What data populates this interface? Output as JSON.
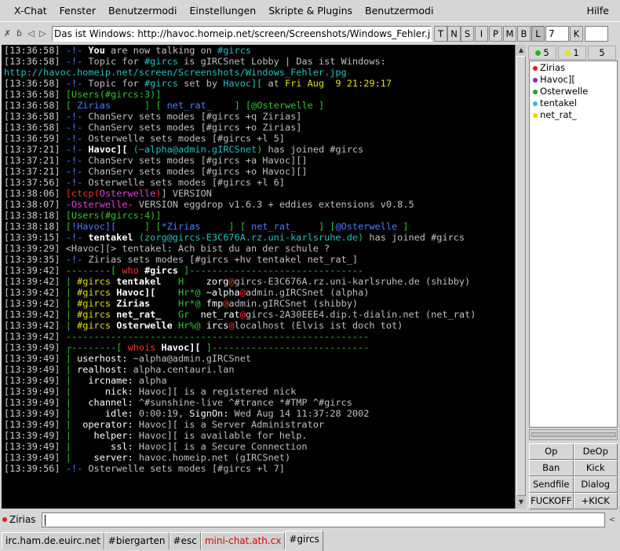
{
  "menubar": {
    "items": [
      "X-Chat",
      "Fenster",
      "Benutzermodi",
      "Einstellungen",
      "Skripte & Plugins",
      "Benutzermodi"
    ],
    "help": "Hilfe"
  },
  "topic": {
    "text": "Das ist Windows: http://havoc.homeip.net/screen/Screenshots/Windows_Fehler.jpg",
    "modes": [
      "T",
      "N",
      "S",
      "I",
      "P",
      "M",
      "B",
      "L"
    ],
    "limit_value": "7",
    "key_label": "K"
  },
  "counts": [
    {
      "color": "#22bb22",
      "value": "5"
    },
    {
      "color": "#e6e600",
      "value": "1"
    },
    {
      "value": "5"
    }
  ],
  "users": [
    {
      "name": "Zirias",
      "color": "#e02020"
    },
    {
      "name": "Havoc][",
      "color": "#9a20c0"
    },
    {
      "name": "Osterwelle",
      "color": "#20a020"
    },
    {
      "name": "tentakel",
      "color": "#20c0e0"
    },
    {
      "name": "net_rat_",
      "color": "#e6d600"
    }
  ],
  "user_buttons": [
    "Op",
    "DeOp",
    "Ban",
    "Kick",
    "Sendfile",
    "Dialog",
    "FUCKOFF",
    "+KICK"
  ],
  "input": {
    "nick": "Zirias",
    "nick_color": "#e02020",
    "value": ""
  },
  "tabs": [
    {
      "label": "irc.ham.de.euirc.net"
    },
    {
      "label": "#biergarten"
    },
    {
      "label": "#esc"
    },
    {
      "label": "mini-chat.ath.cx",
      "red": true
    },
    {
      "label": "#gircs",
      "active": true
    }
  ],
  "chat_lines": [
    [
      [
        "[13:36:58] ",
        "ts"
      ],
      [
        "-!-",
        "c-blue"
      ],
      [
        " You",
        "c-w"
      ],
      [
        " are now talking on ",
        ""
      ],
      [
        "#gircs",
        "c-cyan"
      ]
    ],
    [
      [
        "[13:36:58] ",
        "ts"
      ],
      [
        "-!-",
        "c-blue"
      ],
      [
        " Topic for ",
        ""
      ],
      [
        "#gircs",
        "c-cyan"
      ],
      [
        " is gIRCSnet Lobby | Das ist Windows:",
        ""
      ]
    ],
    [
      [
        "http://havoc.homeip.net/screen/Screenshots/Windows_Fehler.jpg",
        "c-cyan"
      ]
    ],
    [
      [
        "[13:36:58] ",
        "ts"
      ],
      [
        "-!-",
        "c-blue"
      ],
      [
        " Topic for ",
        ""
      ],
      [
        "#gircs",
        "c-cyan"
      ],
      [
        " set by ",
        ""
      ],
      [
        "Havoc][",
        "c-cyan"
      ],
      [
        " at ",
        ""
      ],
      [
        "Fri Aug  9 21:29:17",
        "c-yel"
      ]
    ],
    [
      [
        "[13:36:58] ",
        "ts"
      ],
      [
        "[",
        "c-grn"
      ],
      [
        "Users(#gircs:3)",
        "c-grn"
      ],
      [
        "]",
        "c-grn"
      ]
    ],
    [
      [
        "[13:36:58] ",
        "ts"
      ],
      [
        "[",
        "c-grn"
      ],
      [
        " Zirias      ",
        "c-blue"
      ],
      [
        "] [",
        "c-grn"
      ],
      [
        " net_rat_    ",
        "c-blue"
      ],
      [
        "] [",
        "c-grn"
      ],
      [
        "@Osterwelle ",
        "c-grn"
      ],
      [
        "]",
        "c-grn"
      ]
    ],
    [
      [
        "[13:36:58] ",
        "ts"
      ],
      [
        "-!-",
        "c-blue"
      ],
      [
        " ChanServ sets modes [#gircs +q Zirias]",
        ""
      ]
    ],
    [
      [
        "[13:36:58] ",
        "ts"
      ],
      [
        "-!-",
        "c-blue"
      ],
      [
        " ChanServ sets modes [#gircs +o Zirias]",
        ""
      ]
    ],
    [
      [
        "[13:36:59] ",
        "ts"
      ],
      [
        "-!-",
        "c-blue"
      ],
      [
        " Osterwelle sets modes [#gircs +l 5]",
        ""
      ]
    ],
    [
      [
        "[13:37:21] ",
        "ts"
      ],
      [
        "-!-",
        "c-blue"
      ],
      [
        " Havoc][",
        "c-w"
      ],
      [
        " (",
        "c-grn"
      ],
      [
        "~alpha@admin.gIRCSnet",
        "c-cyan"
      ],
      [
        ")",
        "c-grn"
      ],
      [
        " has joined #gircs",
        ""
      ]
    ],
    [
      [
        "[13:37:21] ",
        "ts"
      ],
      [
        "-!-",
        "c-blue"
      ],
      [
        " ChanServ sets modes [#gircs +a Havoc][]",
        ""
      ]
    ],
    [
      [
        "[13:37:21] ",
        "ts"
      ],
      [
        "-!-",
        "c-blue"
      ],
      [
        " ChanServ sets modes [#gircs +o Havoc][]",
        ""
      ]
    ],
    [
      [
        "[13:37:56] ",
        "ts"
      ],
      [
        "-!-",
        "c-blue"
      ],
      [
        " Osterwelle sets modes [#gircs +l 6]",
        ""
      ]
    ],
    [
      [
        "[13:38:06] ",
        "ts"
      ],
      [
        "[",
        "c-red"
      ],
      [
        "ctcp",
        "c-red"
      ],
      [
        "(",
        "c-red"
      ],
      [
        "Osterwelle",
        "c-mag"
      ],
      [
        ")",
        "c-red"
      ],
      [
        "] VERSION",
        ""
      ]
    ],
    [
      [
        "[13:38:07] ",
        "ts"
      ],
      [
        "-",
        "c-mag"
      ],
      [
        "Osterwelle",
        "c-mag"
      ],
      [
        "-",
        "c-mag"
      ],
      [
        " VERSION eggdrop v1.6.3 + eddies extensions v0.8.5",
        ""
      ]
    ],
    [
      [
        "[13:38:18] ",
        "ts"
      ],
      [
        "[",
        "c-grn"
      ],
      [
        "Users(#gircs:4)",
        "c-grn"
      ],
      [
        "]",
        "c-grn"
      ]
    ],
    [
      [
        "[13:38:18] ",
        "ts"
      ],
      [
        "[",
        "c-grn"
      ],
      [
        "!Havoc][     ",
        "c-blue"
      ],
      [
        "] [",
        "c-grn"
      ],
      [
        "*Zirias     ",
        "c-blue"
      ],
      [
        "] [",
        "c-grn"
      ],
      [
        " net_rat_    ",
        "c-blue"
      ],
      [
        "] [",
        "c-grn"
      ],
      [
        "@Osterwelle ",
        "c-blue"
      ],
      [
        "]",
        "c-grn"
      ]
    ],
    [
      [
        "[13:39:15] ",
        "ts"
      ],
      [
        "-!-",
        "c-blue"
      ],
      [
        " tentakel",
        "c-w"
      ],
      [
        " (",
        "c-grn"
      ],
      [
        "zorg@gircs-E3C676A.rz.uni-karlsruhe.de",
        "c-cyan"
      ],
      [
        ")",
        "c-grn"
      ],
      [
        " has joined #gircs",
        ""
      ]
    ],
    [
      [
        "[13:39:29] ",
        "ts"
      ],
      [
        "<Havoc][> tentakel: Ach bist du an der schule ?",
        ""
      ]
    ],
    [
      [
        "[13:39:35] ",
        "ts"
      ],
      [
        "-!-",
        "c-blue"
      ],
      [
        " Zirias sets modes [#gircs +hv tentakel net_rat_]",
        ""
      ]
    ],
    [
      [
        "[13:39:42] ",
        "ts"
      ],
      [
        "--------[ ",
        "c-grn"
      ],
      [
        "who",
        "c-red"
      ],
      [
        " #gircs",
        "c-w"
      ],
      [
        " ]-------------------------------",
        "c-grn"
      ]
    ],
    [
      [
        "[13:39:42] ",
        "ts"
      ],
      [
        "| ",
        "c-grn"
      ],
      [
        "#gircs",
        "c-yel"
      ],
      [
        " tentakel",
        "c-w"
      ],
      [
        "   H  ",
        "c-grn"
      ],
      [
        "  zorg",
        "c-wh"
      ],
      [
        "@",
        "c-red"
      ],
      [
        "gircs-E3C676A.rz.uni-karlsruhe.de (shibby)",
        ""
      ]
    ],
    [
      [
        "[13:39:42] ",
        "ts"
      ],
      [
        "| ",
        "c-grn"
      ],
      [
        "#gircs",
        "c-yel"
      ],
      [
        " Havoc][",
        "c-w"
      ],
      [
        "    Hr*@",
        "c-grn"
      ],
      [
        " ~alpha",
        "c-wh"
      ],
      [
        "@",
        "c-red"
      ],
      [
        "admin.gIRCSnet (alpha)",
        ""
      ]
    ],
    [
      [
        "[13:39:42] ",
        "ts"
      ],
      [
        "| ",
        "c-grn"
      ],
      [
        "#gircs",
        "c-yel"
      ],
      [
        " Zirias",
        "c-w"
      ],
      [
        "     Hr*@",
        "c-grn"
      ],
      [
        " fmp",
        "c-wh"
      ],
      [
        "@",
        "c-red"
      ],
      [
        "admin.gIRCSnet (shibby)",
        ""
      ]
    ],
    [
      [
        "[13:39:42] ",
        "ts"
      ],
      [
        "| ",
        "c-grn"
      ],
      [
        "#gircs",
        "c-yel"
      ],
      [
        " net_rat_",
        "c-w"
      ],
      [
        "   Gr ",
        "c-grn"
      ],
      [
        " net_rat",
        "c-wh"
      ],
      [
        "@",
        "c-red"
      ],
      [
        "gircs-2A30EEE4.dip.t-dialin.net (net_rat)",
        ""
      ]
    ],
    [
      [
        "[13:39:42] ",
        "ts"
      ],
      [
        "| ",
        "c-grn"
      ],
      [
        "#gircs",
        "c-yel"
      ],
      [
        " Osterwelle",
        "c-w"
      ],
      [
        " Hr%@",
        "c-grn"
      ],
      [
        " ircs",
        "c-wh"
      ],
      [
        "@",
        "c-red"
      ],
      [
        "localhost (Elvis ist doch tot)",
        ""
      ]
    ],
    [
      [
        "[13:39:42] ",
        "ts"
      ],
      [
        "------------------------------------------------------",
        "c-grn"
      ]
    ],
    [
      [
        "[13:39:49] ",
        "ts"
      ],
      [
        "┌--------[ ",
        "c-grn"
      ],
      [
        "whois",
        "c-red"
      ],
      [
        " Havoc][",
        "c-w"
      ],
      [
        " ]----------------------------",
        "c-grn"
      ]
    ],
    [
      [
        "[13:39:49] ",
        "ts"
      ],
      [
        "| ",
        "c-grn"
      ],
      [
        "userhost:",
        "c-wh"
      ],
      [
        " ~alpha@admin.gIRCSnet",
        ""
      ]
    ],
    [
      [
        "[13:39:49] ",
        "ts"
      ],
      [
        "| ",
        "c-grn"
      ],
      [
        "realhost:",
        "c-wh"
      ],
      [
        " alpha.centauri.lan",
        ""
      ]
    ],
    [
      [
        "[13:39:49] ",
        "ts"
      ],
      [
        "|   ",
        "c-grn"
      ],
      [
        "ircname:",
        "c-wh"
      ],
      [
        " alpha",
        ""
      ]
    ],
    [
      [
        "[13:39:49] ",
        "ts"
      ],
      [
        "|      ",
        "c-grn"
      ],
      [
        "nick:",
        "c-wh"
      ],
      [
        " Havoc][ is a registered nick",
        ""
      ]
    ],
    [
      [
        "[13:39:49] ",
        "ts"
      ],
      [
        "|   ",
        "c-grn"
      ],
      [
        "channel:",
        "c-wh"
      ],
      [
        " ^#sunshine-live ^#trance *#TMP ^#gircs",
        ""
      ]
    ],
    [
      [
        "[13:39:49] ",
        "ts"
      ],
      [
        "|      ",
        "c-grn"
      ],
      [
        "idle:",
        "c-wh"
      ],
      [
        " 0:00:19, ",
        ""
      ],
      [
        "SignOn:",
        "c-wh"
      ],
      [
        " Wed Aug 14 11:37:28 2002",
        ""
      ]
    ],
    [
      [
        "[13:39:49] ",
        "ts"
      ],
      [
        "|  ",
        "c-grn"
      ],
      [
        "operator:",
        "c-wh"
      ],
      [
        " Havoc][ is a Server Administrator",
        ""
      ]
    ],
    [
      [
        "[13:39:49] ",
        "ts"
      ],
      [
        "|    ",
        "c-grn"
      ],
      [
        "helper:",
        "c-wh"
      ],
      [
        " Havoc][ is available for help.",
        ""
      ]
    ],
    [
      [
        "[13:39:49] ",
        "ts"
      ],
      [
        "|       ",
        "c-grn"
      ],
      [
        "ssl:",
        "c-wh"
      ],
      [
        " Havoc][ is a Secure Connection",
        ""
      ]
    ],
    [
      [
        "[13:39:49] ",
        "ts"
      ],
      [
        "|    ",
        "c-grn"
      ],
      [
        "server:",
        "c-wh"
      ],
      [
        " havoc.homeip.net (gIRCSnet)",
        ""
      ]
    ],
    [
      [
        "[13:39:56] ",
        "ts"
      ],
      [
        "-!-",
        "c-blue"
      ],
      [
        " Osterwelle sets modes [#gircs +l 7]",
        ""
      ]
    ]
  ]
}
